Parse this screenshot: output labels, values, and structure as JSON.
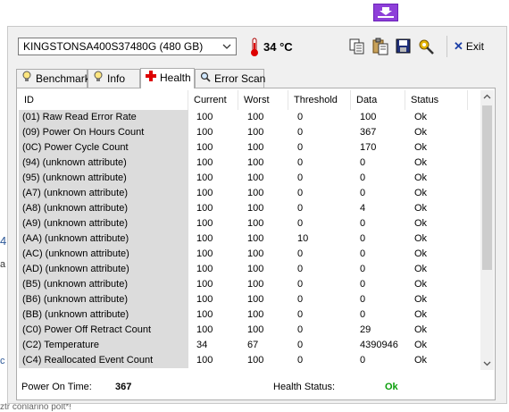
{
  "drive": {
    "name": "KINGSTONSA400S37480G (480 GB)"
  },
  "temperature": {
    "value": "34 °C"
  },
  "toolbar": {
    "buttons": [
      {
        "name": "copy-button",
        "icon": "copy-icon"
      },
      {
        "name": "paste-button",
        "icon": "clipboard-icon"
      },
      {
        "name": "save-button",
        "icon": "floppy-disk-icon"
      },
      {
        "name": "tools-button",
        "icon": "tools-icon"
      }
    ],
    "exit_label": "Exit"
  },
  "tabs": [
    {
      "label": "Benchmark",
      "icon": "lightbulb-icon"
    },
    {
      "label": "Info",
      "icon": "info-icon"
    },
    {
      "label": "Health",
      "icon": "health-cross-icon",
      "active": true
    },
    {
      "label": "Error Scan",
      "icon": "magnifier-icon"
    }
  ],
  "table": {
    "columns": [
      "ID",
      "Current",
      "Worst",
      "Threshold",
      "Data",
      "Status"
    ],
    "rows": [
      [
        "(01) Raw Read Error Rate",
        "100",
        "100",
        "0",
        "100",
        "Ok"
      ],
      [
        "(09) Power On Hours Count",
        "100",
        "100",
        "0",
        "367",
        "Ok"
      ],
      [
        "(0C) Power Cycle Count",
        "100",
        "100",
        "0",
        "170",
        "Ok"
      ],
      [
        "(94) (unknown attribute)",
        "100",
        "100",
        "0",
        "0",
        "Ok"
      ],
      [
        "(95) (unknown attribute)",
        "100",
        "100",
        "0",
        "0",
        "Ok"
      ],
      [
        "(A7) (unknown attribute)",
        "100",
        "100",
        "0",
        "0",
        "Ok"
      ],
      [
        "(A8) (unknown attribute)",
        "100",
        "100",
        "0",
        "4",
        "Ok"
      ],
      [
        "(A9) (unknown attribute)",
        "100",
        "100",
        "0",
        "0",
        "Ok"
      ],
      [
        "(AA) (unknown attribute)",
        "100",
        "100",
        "10",
        "0",
        "Ok"
      ],
      [
        "(AC) (unknown attribute)",
        "100",
        "100",
        "0",
        "0",
        "Ok"
      ],
      [
        "(AD) (unknown attribute)",
        "100",
        "100",
        "0",
        "0",
        "Ok"
      ],
      [
        "(B5) (unknown attribute)",
        "100",
        "100",
        "0",
        "0",
        "Ok"
      ],
      [
        "(B6) (unknown attribute)",
        "100",
        "100",
        "0",
        "0",
        "Ok"
      ],
      [
        "(BB) (unknown attribute)",
        "100",
        "100",
        "0",
        "0",
        "Ok"
      ],
      [
        "(C0) Power Off Retract Count",
        "100",
        "100",
        "0",
        "29",
        "Ok"
      ],
      [
        "(C2) Temperature",
        "34",
        "67",
        "0",
        "4390946",
        "Ok"
      ],
      [
        "(C4) Reallocated Event Count",
        "100",
        "100",
        "0",
        "0",
        "Ok"
      ]
    ]
  },
  "status": {
    "power_on_label": "Power On Time:",
    "power_on_value": "367",
    "health_label": "Health Status:",
    "health_value": "Ok",
    "health_color": "#0a9e0a"
  },
  "background": {
    "bottom_text": "ztr conlarino polt*!"
  }
}
